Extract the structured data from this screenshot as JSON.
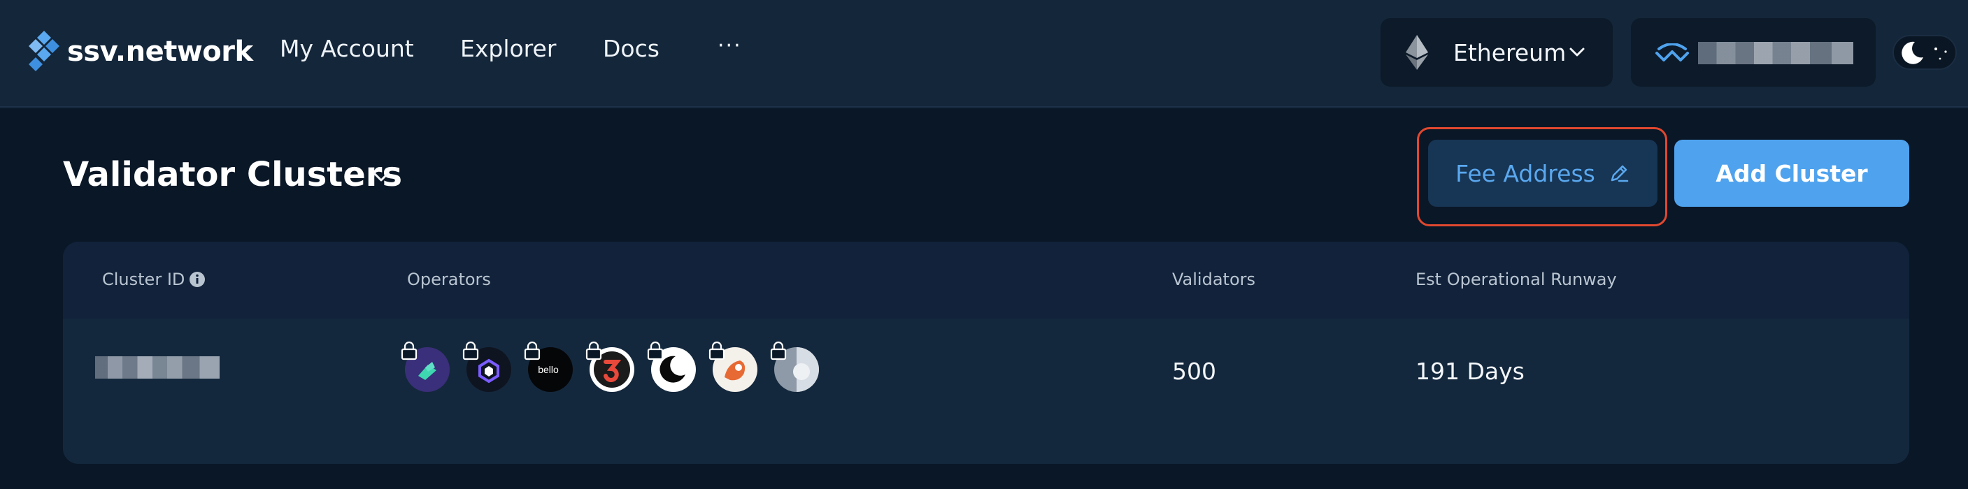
{
  "brand": {
    "name": "ssv.network"
  },
  "nav": {
    "items": [
      "My Account",
      "Explorer",
      "Docs"
    ],
    "more_label": "···"
  },
  "network": {
    "label": "Ethereum",
    "icon": "ethereum-icon"
  },
  "wallet": {
    "icon": "walletconnect-icon",
    "address_state": "redacted"
  },
  "theme_toggle": {
    "mode": "dark",
    "icon": "moon-icon"
  },
  "page": {
    "title": "Validator Clusters"
  },
  "actions": {
    "fee_address_label": "Fee Address",
    "add_cluster_label": "Add Cluster"
  },
  "table": {
    "columns": [
      "Cluster ID",
      "Operators",
      "Validators",
      "Est Operational Runway"
    ],
    "rows": [
      {
        "cluster_id_state": "redacted",
        "operators": [
          "operator-1",
          "operator-2",
          "operator-3",
          "operator-4",
          "operator-5",
          "operator-6",
          "operator-7"
        ],
        "operator_badge_text": "bello",
        "validators": "500",
        "runway": "191 Days"
      }
    ]
  },
  "colors": {
    "header_bg": "#14263a",
    "page_bg": "#0a1727",
    "accent": "#4fa3ee",
    "fee_button_bg": "#173554",
    "highlight": "#e0482f"
  }
}
